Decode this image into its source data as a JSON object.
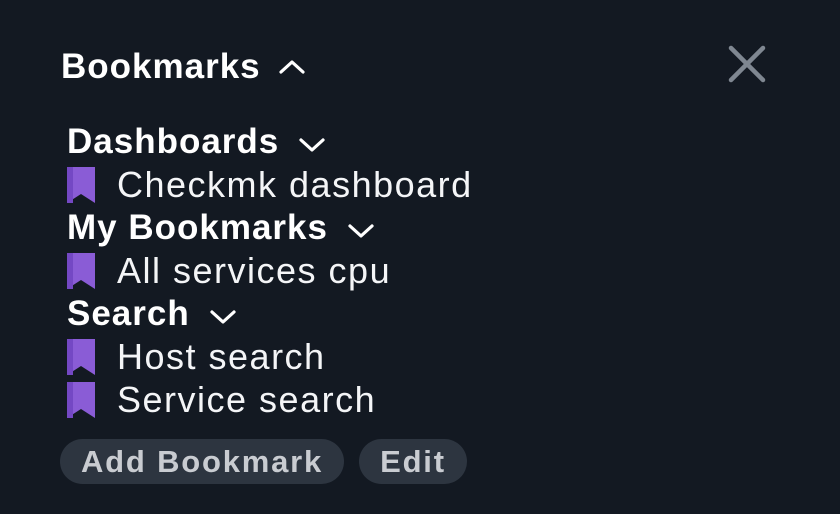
{
  "header": {
    "title": "Bookmarks",
    "toggle_icon": "chevron-up-icon"
  },
  "close_icon": "close-icon",
  "colors": {
    "background": "#131922",
    "bookmark": "#8a5cd6",
    "button_bg": "#2d3540",
    "button_text": "#c9ccd1"
  },
  "groups": [
    {
      "title": "Dashboards",
      "items": [
        {
          "label": "Checkmk dashboard"
        }
      ]
    },
    {
      "title": "My Bookmarks",
      "items": [
        {
          "label": "All services cpu"
        }
      ]
    },
    {
      "title": "Search",
      "items": [
        {
          "label": "Host search"
        },
        {
          "label": "Service search"
        }
      ]
    }
  ],
  "buttons": {
    "add_bookmark": "Add Bookmark",
    "edit": "Edit"
  }
}
